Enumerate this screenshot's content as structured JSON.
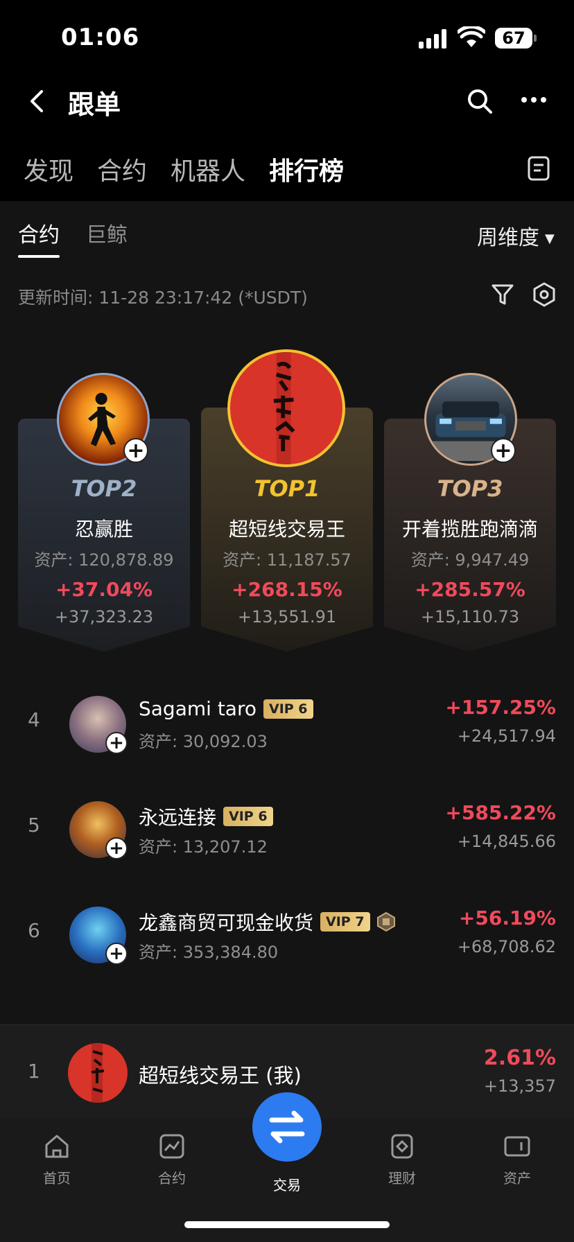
{
  "status": {
    "time": "01:06",
    "battery": "67"
  },
  "header": {
    "title": "跟单"
  },
  "top_tabs": [
    "发现",
    "合约",
    "机器人",
    "排行榜"
  ],
  "sub_tabs": [
    "合约",
    "巨鲸"
  ],
  "period": "周维度",
  "updated_text": "更新时间: 11-28 23:17:42 (*USDT)",
  "podium": [
    {
      "rank": "TOP2",
      "name": "忍赢胜",
      "assets": "资产: 120,878.89",
      "pct": "+37.04%",
      "pnl": "+37,323.23",
      "rank_color": "#9fb0c8"
    },
    {
      "rank": "TOP1",
      "name": "超短线交易王",
      "assets": "资产: 11,187.57",
      "pct": "+268.15%",
      "pnl": "+13,551.91",
      "rank_color": "#f2c230"
    },
    {
      "rank": "TOP3",
      "name": "开着揽胜跑滴滴",
      "assets": "资产: 9,947.49",
      "pct": "+285.57%",
      "pnl": "+15,110.73",
      "rank_color": "#d9b38c"
    }
  ],
  "list": [
    {
      "idx": "4",
      "name": "Sagami taro",
      "vip": "VIP 6",
      "medal": false,
      "assets": "资产: 30,092.03",
      "pct": "+157.25%",
      "pnl": "+24,517.94"
    },
    {
      "idx": "5",
      "name": "永远连接",
      "vip": "VIP 6",
      "medal": false,
      "assets": "资产: 13,207.12",
      "pct": "+585.22%",
      "pnl": "+14,845.66"
    },
    {
      "idx": "6",
      "name": "龙鑫商贸可现金收货",
      "vip": "VIP 7",
      "medal": true,
      "assets": "资产: 353,384.80",
      "pct": "+56.19%",
      "pnl": "+68,708.62"
    }
  ],
  "mine": {
    "idx": "1",
    "name": "超短线交易王 (我)",
    "pct": "2.61%",
    "pnl": "+13,357"
  },
  "bottom_tabs": [
    "首页",
    "合约",
    "交易",
    "理财",
    "资产"
  ],
  "colors": {
    "positive": "#f04a5c",
    "accent": "#2d7bf0",
    "vip": "#e8c676"
  }
}
